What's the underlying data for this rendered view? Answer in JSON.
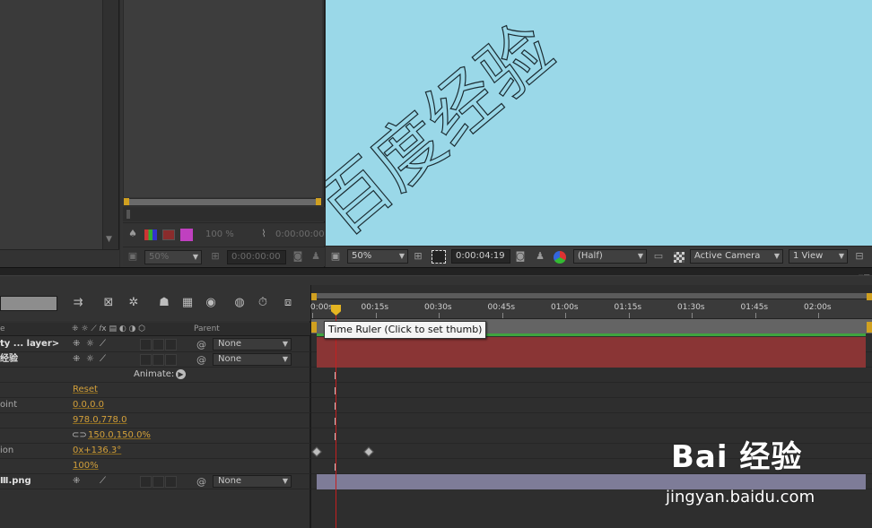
{
  "colors": {
    "comp_background": "#9ad8e8",
    "layer_bar_red": "#8a3535",
    "layer_bar_purple": "#7e7c98",
    "value_orange": "#d3a03a",
    "cti_red": "#c42020",
    "keyframe_gray": "#bdbdbd"
  },
  "middle_panel": {
    "zoom_value": "100 %",
    "timecode": "0:00:00:00",
    "zoom_dropdown": "50%",
    "timecode2": "0:00:00:00"
  },
  "composition": {
    "canvas_text": "百度经验",
    "zoom_dropdown": "50%",
    "timecode": "0:00:04:19",
    "resolution_dropdown": "(Half)",
    "camera_dropdown": "Active Camera",
    "view_dropdown": "1 View"
  },
  "timeline": {
    "column_headers": {
      "name": "e",
      "parent": "Parent"
    },
    "rows": [
      {
        "label": "ty ... layer>",
        "kind": "layer",
        "parent": "None"
      },
      {
        "label": "经验",
        "kind": "layer",
        "parent": "None"
      },
      {
        "label": "Animate:",
        "kind": "animate"
      },
      {
        "label": "",
        "kind": "prop",
        "value": "Reset"
      },
      {
        "label": "oint",
        "kind": "prop",
        "value": "0.0,0.0"
      },
      {
        "label": "",
        "kind": "prop",
        "value": "978.0,778.0"
      },
      {
        "label": "",
        "kind": "prop",
        "value": "150.0,150.0%"
      },
      {
        "label": "ion",
        "kind": "prop",
        "value": "0x+136.3°"
      },
      {
        "label": "",
        "kind": "prop",
        "value": "100%"
      },
      {
        "label": "Ⅲ.png",
        "kind": "layer",
        "parent": "None"
      }
    ],
    "ruler_labels": [
      "0:00s",
      "00:15s",
      "00:30s",
      "00:45s",
      "01:00s",
      "01:15s",
      "01:30s",
      "01:45s",
      "02:00s"
    ],
    "tooltip": "Time Ruler (Click to set thumb)"
  },
  "watermark": {
    "logo_text": "Bai 经验",
    "url": "jingyan.baidu.com"
  }
}
